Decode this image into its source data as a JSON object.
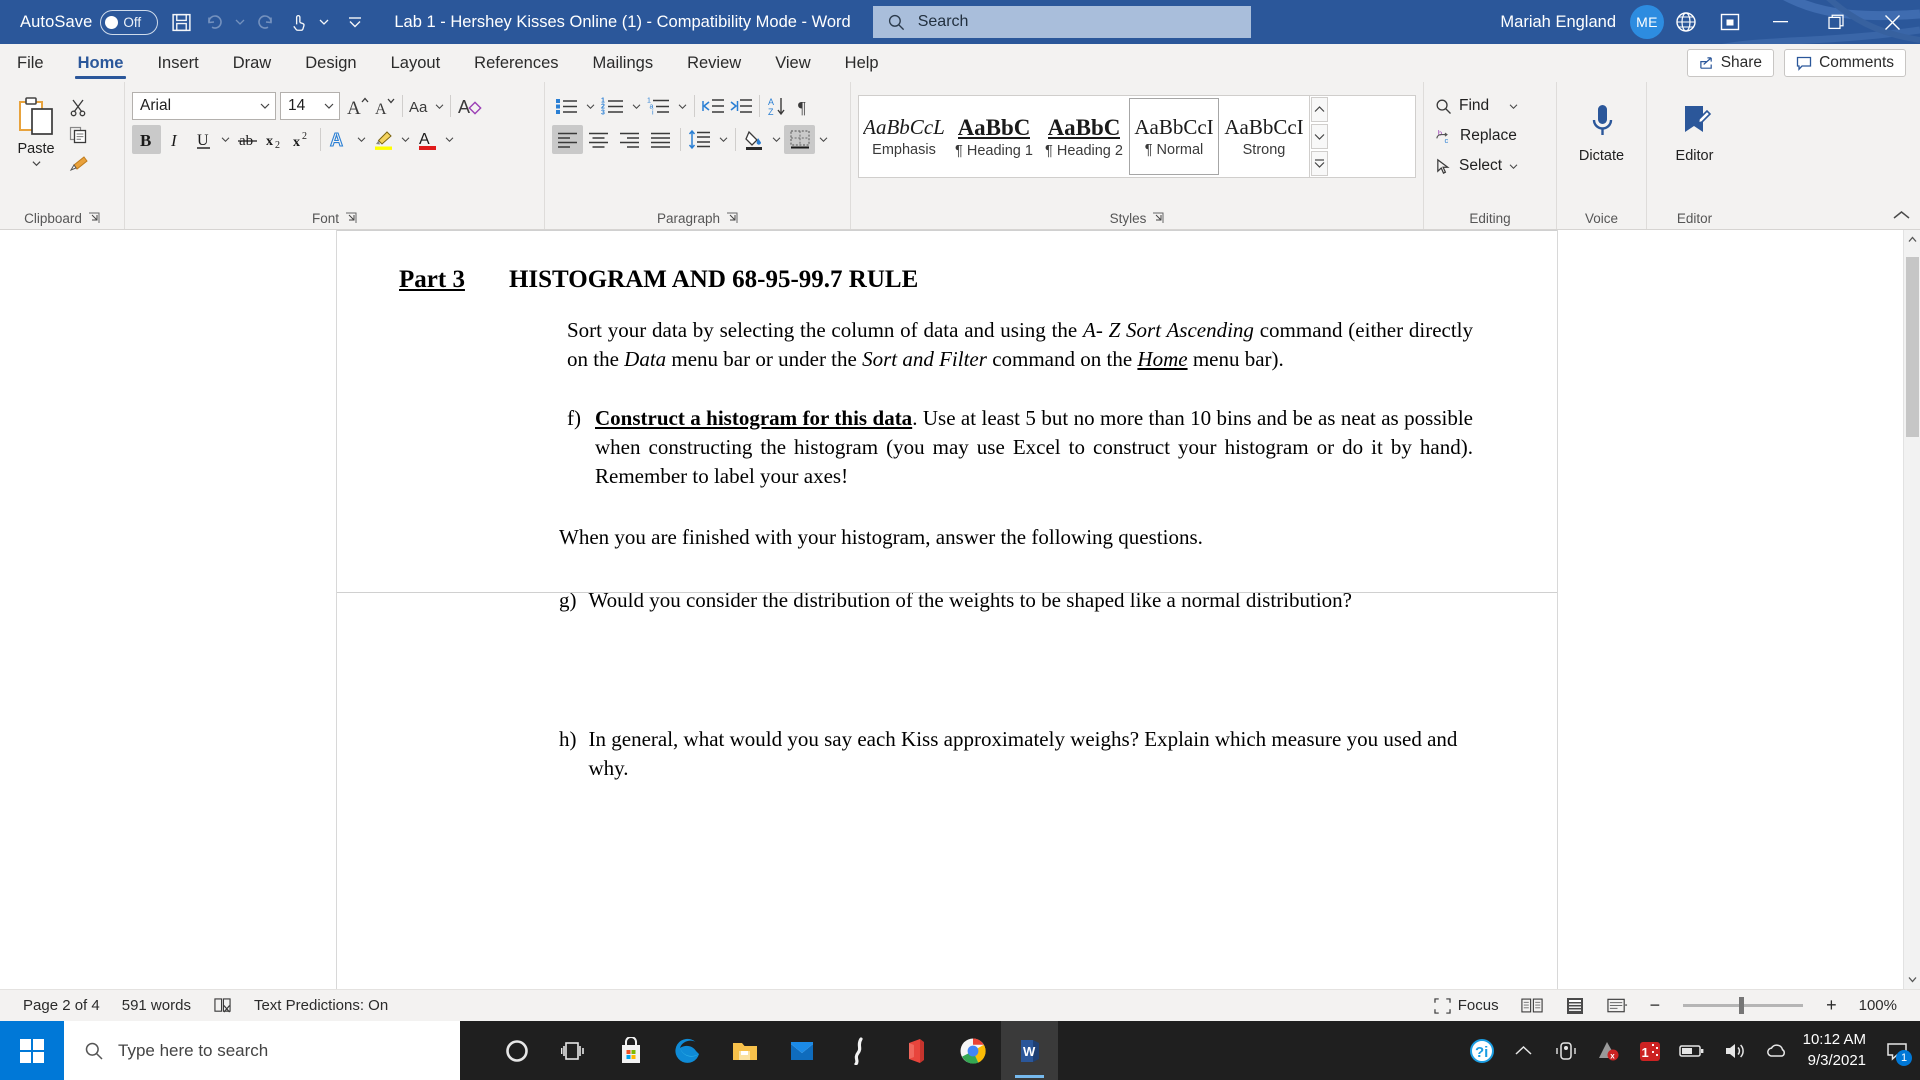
{
  "titlebar": {
    "autosave_label": "AutoSave",
    "autosave_state": "Off",
    "document_title": "Lab 1 - Hershey Kisses Online (1)  -  Compatibility Mode  -  Word",
    "search_placeholder": "Search",
    "account_name": "Mariah England",
    "account_initials": "ME",
    "icons": [
      "save-icon",
      "undo-icon",
      "redo-icon",
      "touch-mode-icon",
      "customize-quick-access-icon"
    ],
    "accent_color": "#2b579a"
  },
  "tabs": [
    {
      "label": "File",
      "active": false
    },
    {
      "label": "Home",
      "active": true
    },
    {
      "label": "Insert",
      "active": false
    },
    {
      "label": "Draw",
      "active": false
    },
    {
      "label": "Design",
      "active": false
    },
    {
      "label": "Layout",
      "active": false
    },
    {
      "label": "References",
      "active": false
    },
    {
      "label": "Mailings",
      "active": false
    },
    {
      "label": "Review",
      "active": false
    },
    {
      "label": "View",
      "active": false
    },
    {
      "label": "Help",
      "active": false
    }
  ],
  "tab_actions": {
    "share_label": "Share",
    "comments_label": "Comments"
  },
  "ribbon": {
    "clipboard": {
      "label": "Clipboard",
      "paste_label": "Paste",
      "buttons": [
        "cut-icon",
        "copy-icon",
        "format-painter-icon"
      ]
    },
    "font": {
      "label": "Font",
      "font_name": "Arial",
      "font_size": "14",
      "buttons": [
        "grow-font-icon",
        "shrink-font-icon",
        "change-case-icon",
        "clear-formatting-icon",
        "bold-icon",
        "italic-icon",
        "underline-icon",
        "strikethrough-icon",
        "subscript-icon",
        "superscript-icon",
        "text-effects-icon",
        "text-highlight-icon",
        "font-color-icon"
      ],
      "bold_active": true
    },
    "paragraph": {
      "label": "Paragraph",
      "buttons": [
        "bullets-icon",
        "numbering-icon",
        "multilevel-list-icon",
        "decrease-indent-icon",
        "increase-indent-icon",
        "sort-icon",
        "show-marks-icon",
        "align-left-icon",
        "align-center-icon",
        "align-right-icon",
        "justify-icon",
        "line-spacing-icon",
        "shading-icon",
        "borders-icon"
      ],
      "align_left_active": true
    },
    "styles": {
      "label": "Styles",
      "items": [
        {
          "preview": "AaBbCcL",
          "name": "Emphasis",
          "selected": false
        },
        {
          "preview": "AaBbC",
          "name": "¶ Heading 1",
          "selected": false
        },
        {
          "preview": "AaBbC",
          "name": "¶ Heading 2",
          "selected": false
        },
        {
          "preview": "AaBbCcI",
          "name": "¶ Normal",
          "selected": true
        },
        {
          "preview": "AaBbCcI",
          "name": "Strong",
          "selected": false
        }
      ]
    },
    "editing": {
      "label": "Editing",
      "items": [
        {
          "label": "Find",
          "icon": "search-icon",
          "caret": true
        },
        {
          "label": "Replace",
          "icon": "replace-icon",
          "caret": false
        },
        {
          "label": "Select",
          "icon": "select-icon",
          "caret": true
        }
      ]
    },
    "voice": {
      "label": "Voice",
      "dictate_label": "Dictate",
      "icon": "microphone-icon"
    },
    "editor": {
      "label": "Editor",
      "editor_label": "Editor",
      "icon": "editor-pen-icon"
    }
  },
  "document": {
    "heading": {
      "part": "Part 3",
      "title": "HISTOGRAM AND 68-95-99.7 RULE"
    },
    "paragraph_1": {
      "seg1": "Sort your data by selecting the column of data and using the ",
      "em1": "A- Z Sort Ascending",
      "seg2": " command (either directly on the ",
      "em2": "Data",
      "seg3": " menu bar or under the ",
      "em3": "Sort and Filter",
      "seg4": " command on the ",
      "em4": "Home",
      "seg5": " menu bar)."
    },
    "item_f": {
      "marker": "f)",
      "bold": "Construct a histogram for this data",
      "rest": ". Use at least 5 but no more than 10 bins and be as neat as possible when constructing the histogram (you may use Excel to construct your histogram or do it by hand).  Remember to label your axes!"
    },
    "paragraph_2": "When you are finished with your histogram, answer the following questions.",
    "item_g": {
      "marker": "g)",
      "text": "Would you consider the distribution of the weights to be shaped like a normal distribution?"
    },
    "item_h": {
      "marker": "h)",
      "text": "In general, what would you say each Kiss approximately weighs? Explain which measure you used and why."
    }
  },
  "statusbar": {
    "page": "Page 2 of 4",
    "words": "591 words",
    "proofing_icon": "proofing-errors-icon",
    "text_predictions": "Text Predictions: On",
    "focus_label": "Focus",
    "views": [
      "read-mode-icon",
      "print-layout-icon",
      "web-layout-icon"
    ],
    "zoom_out": "−",
    "zoom_in": "+",
    "zoom_level": "100%"
  },
  "taskbar": {
    "search_placeholder": "Type here to search",
    "apps": [
      "cortana-icon",
      "task-view-icon",
      "microsoft-store-icon",
      "edge-icon",
      "file-explorer-icon",
      "mail-icon",
      "slack-icon",
      "office-icon",
      "chrome-icon",
      "word-icon"
    ],
    "tray": [
      "help-icon",
      "show-hidden-icons-icon",
      "webcam-icon",
      "avast-icon",
      "malwarebytes-icon",
      "battery-icon",
      "volume-icon",
      "onedrive-icon"
    ],
    "time": "10:12 AM",
    "date": "9/3/2021",
    "notification_count": "1"
  }
}
